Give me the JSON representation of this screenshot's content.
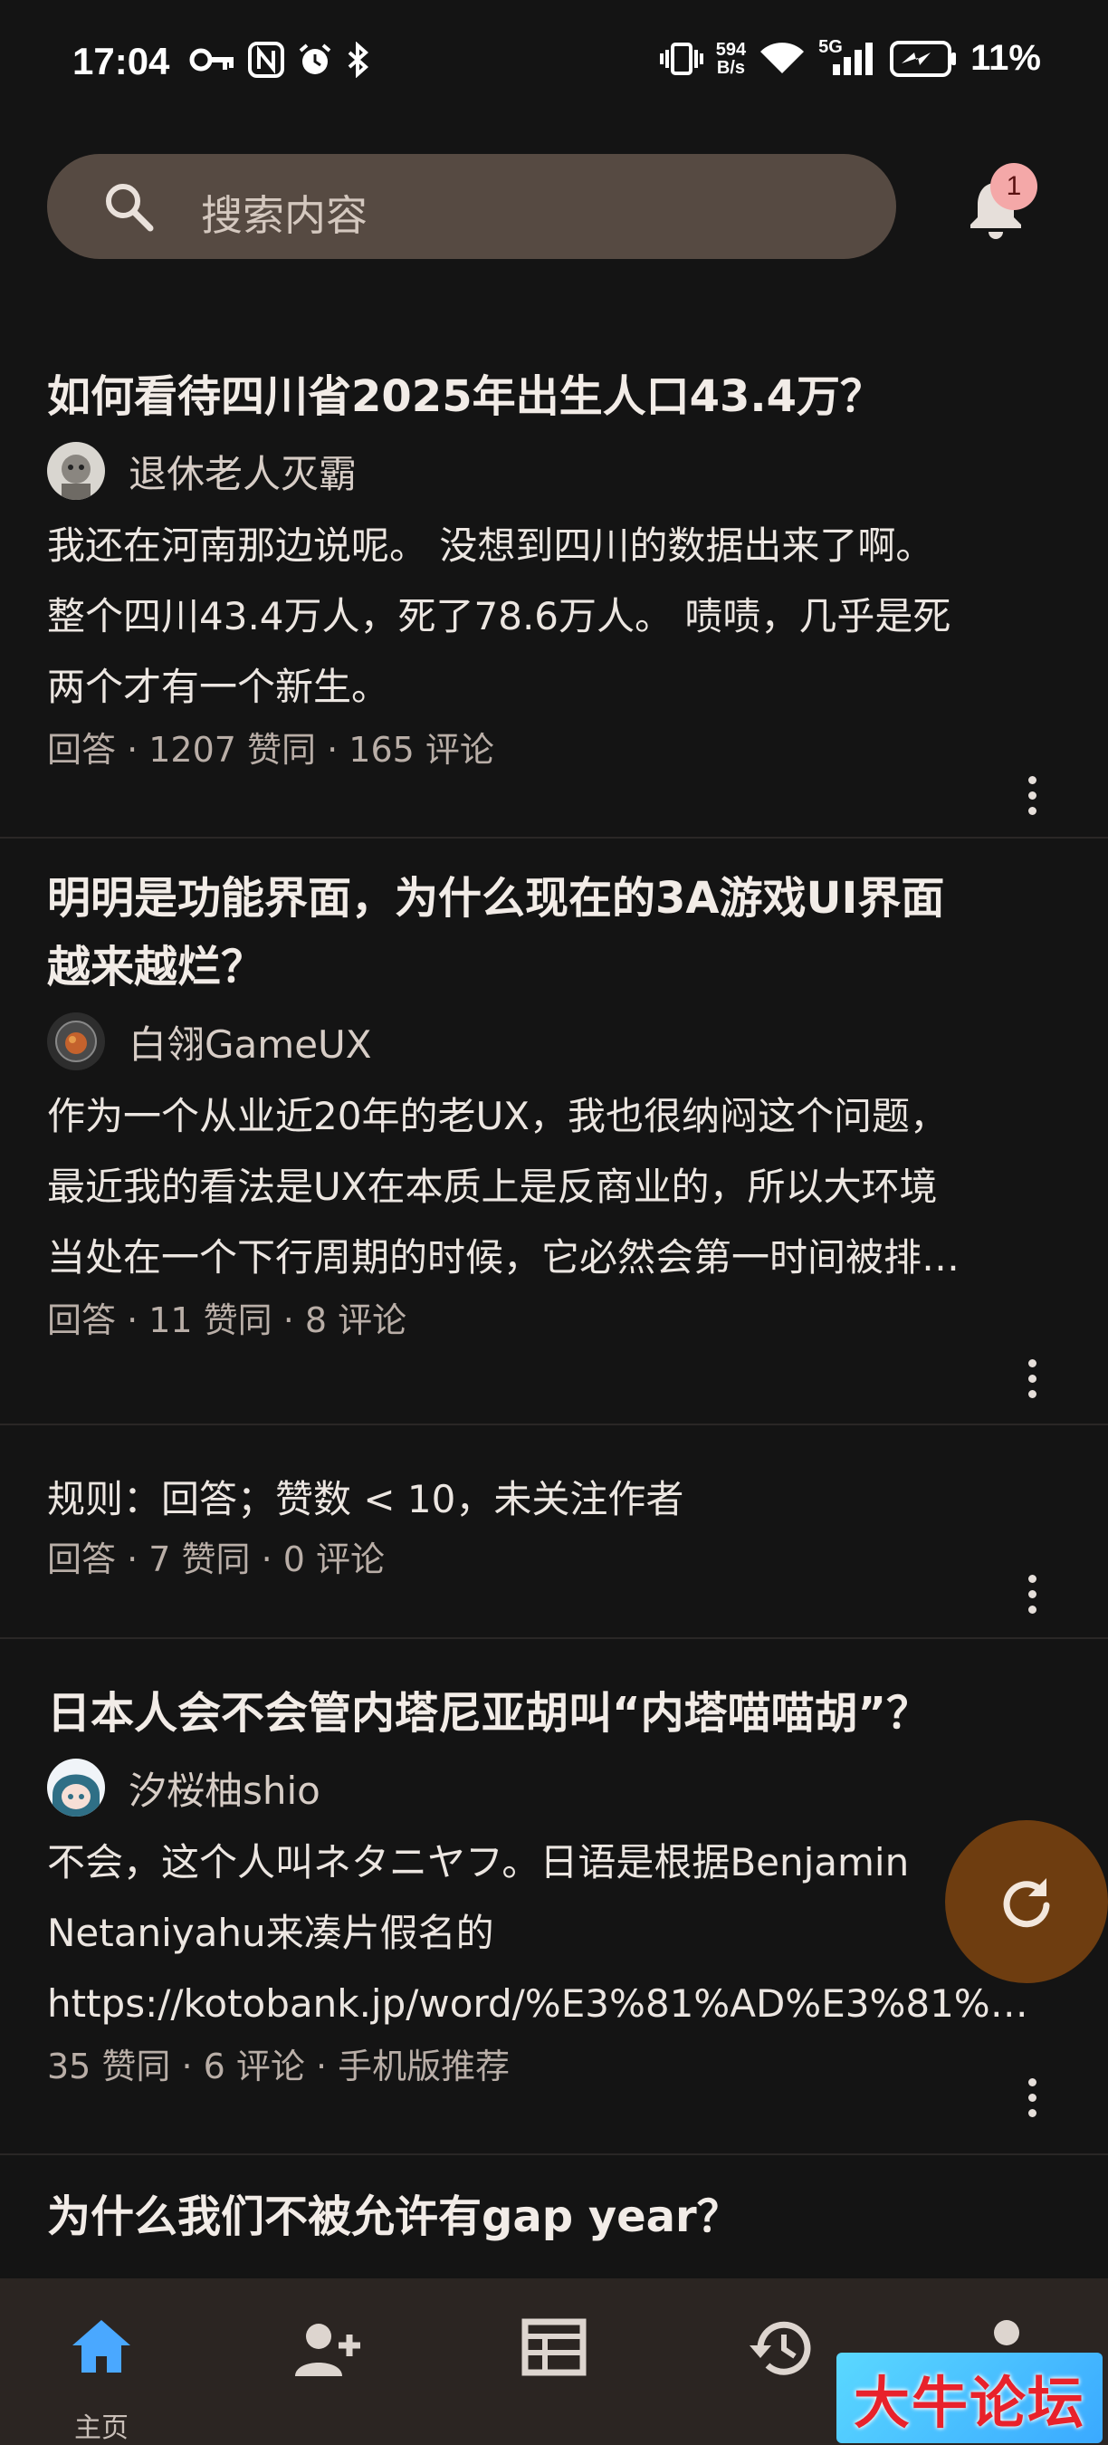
{
  "status_bar": {
    "time": "17:04",
    "net_speed_value": "594",
    "net_speed_unit": "B/s",
    "network": "5G",
    "battery": "11%"
  },
  "search": {
    "placeholder": "搜索内容"
  },
  "notifications": {
    "badge_count": "1"
  },
  "feed": [
    {
      "title": "如何看待四川省2025年出生人口43.4万？",
      "author": "退休老人灭霸",
      "excerpt_lines": [
        "我还在河南那边说呢。 没想到四川的数据出来了啊。",
        "整个四川43.4万人，死了78.6万人。 啧啧，几乎是死",
        "两个才有一个新生。"
      ],
      "meta": "回答 · 1207 赞同 · 165 评论"
    },
    {
      "title_lines": [
        "明明是功能界面，为什么现在的3A游戏UI界面",
        "越来越烂？"
      ],
      "author": "白翎GameUX",
      "excerpt_lines": [
        "作为一个从业近20年的老UX，我也很纳闷这个问题，",
        "最近我的看法是UX在本质上是反商业的，所以大环境",
        "当处在一个下行周期的时候，它必然会第一时间被排…"
      ],
      "meta": "回答 · 11 赞同 · 8 评论"
    },
    {
      "rule": "规则：回答；赞数 < 10，未关注作者",
      "meta": "回答 · 7 赞同 · 0 评论"
    },
    {
      "title": "日本人会不会管内塔尼亚胡叫“内塔喵喵胡”？",
      "author": "汐桜柚shio",
      "excerpt_lines": [
        "不会，这个人叫ネタニヤフ。日语是根据Benjamin",
        "Netaniyahu来凑片假名的",
        "https://kotobank.jp/word/%E3%81%AD%E3%81%9…"
      ],
      "meta": "35 赞同 · 6 评论 · 手机版推荐"
    },
    {
      "title": "为什么我们不被允许有gap year？"
    }
  ],
  "bottom_nav": {
    "home_label": "主页",
    "items": [
      "home-icon",
      "add-person-icon",
      "table-icon",
      "history-icon",
      "person-icon"
    ]
  },
  "watermark": "大牛论坛",
  "colors": {
    "background": "#141414",
    "search_bg": "#564a42",
    "fab": "#6e3d10",
    "nav_active": "#4aa8ff",
    "badge": "#f4a8a8"
  }
}
